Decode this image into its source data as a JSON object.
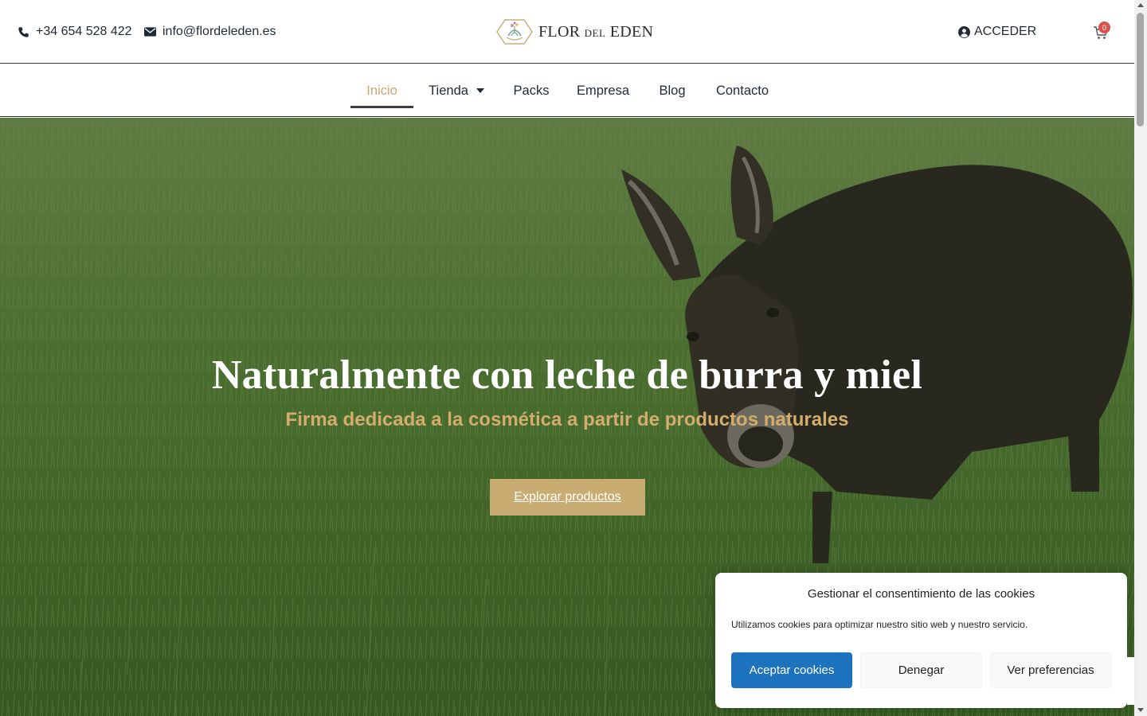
{
  "header": {
    "phone": "+34 654 528 422",
    "email": "info@flordeleden.es",
    "logo": {
      "part1": "FLOR",
      "part2": "DEL",
      "part3": "EDEN"
    },
    "login_label": "ACCEDER",
    "cart_count": "0",
    "icons": {
      "phone": "phone-icon",
      "email": "envelope-icon",
      "user": "user-circle-icon",
      "cart": "cart-icon"
    }
  },
  "nav": {
    "items": [
      {
        "label": "Inicio",
        "active": true
      },
      {
        "label": "Tienda",
        "dropdown": true
      },
      {
        "label": "Packs"
      },
      {
        "label": "Empresa"
      },
      {
        "label": "Blog"
      },
      {
        "label": "Contacto"
      }
    ]
  },
  "hero": {
    "title": "Naturalmente con leche de burra y miel",
    "subtitle": "Firma dedicada a la cosmética a partir de productos naturales",
    "button_label": "Explorar productos"
  },
  "cookie": {
    "title": "Gestionar el consentimiento de las cookies",
    "text": "Utilizamos cookies para optimizar nuestro sitio web y nuestro servicio.",
    "accept_label": "Aceptar cookies",
    "deny_label": "Denegar",
    "prefs_label": "Ver preferencias"
  },
  "colors": {
    "accent_gold": "#c9ac72",
    "accept_blue": "#1e73be",
    "badge_red": "#d9534f",
    "text_dark": "#1f2a36"
  }
}
